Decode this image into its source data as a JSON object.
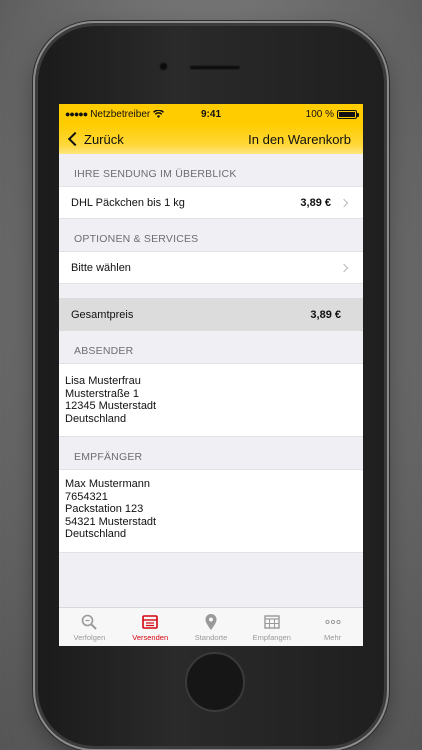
{
  "status_bar": {
    "carrier": "Netzbetreiber",
    "time": "9:41",
    "battery": "100 %"
  },
  "nav": {
    "back_label": "Zurück",
    "right_label": "In den Warenkorb"
  },
  "overview": {
    "header": "IHRE SENDUNG IM ÜBERBLICK",
    "product": "DHL Päckchen bis 1 kg",
    "price": "3,89 €"
  },
  "options": {
    "header": "OPTIONEN & SERVICES",
    "placeholder": "Bitte wählen"
  },
  "total": {
    "label": "Gesamtpreis",
    "price": "3,89 €"
  },
  "sender": {
    "header": "ABSENDER",
    "lines": [
      "Lisa Musterfrau",
      "Musterstraße 1",
      "12345 Musterstadt",
      "Deutschland"
    ]
  },
  "recipient": {
    "header": "EMPFÄNGER",
    "lines": [
      "Max Mustermann",
      "7654321",
      "Packstation 123",
      "54321 Musterstadt",
      "Deutschland"
    ]
  },
  "tabs": [
    {
      "label": "Verfolgen",
      "icon": "magnifier-icon",
      "active": false
    },
    {
      "label": "Versenden",
      "icon": "package-send-icon",
      "active": true
    },
    {
      "label": "Standorte",
      "icon": "location-pin-icon",
      "active": false
    },
    {
      "label": "Empfangen",
      "icon": "packstation-icon",
      "active": false
    },
    {
      "label": "Mehr",
      "icon": "more-dots-icon",
      "active": false
    }
  ],
  "colors": {
    "brand_yellow": "#ffcc00",
    "brand_red": "#d40511"
  }
}
